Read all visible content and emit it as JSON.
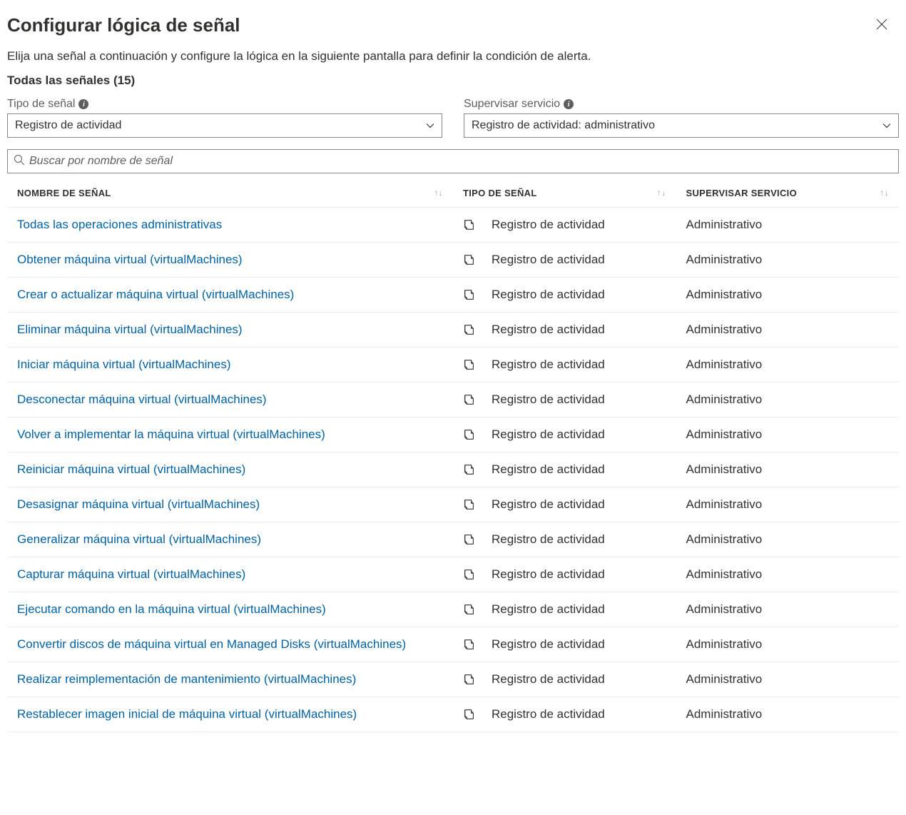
{
  "header": {
    "title": "Configurar lógica de señal"
  },
  "description": "Elija una señal a continuación y configure la lógica en la siguiente pantalla para definir la condición de alerta.",
  "countLabel": "Todas las señales (15)",
  "filters": {
    "signalType": {
      "label": "Tipo de señal",
      "value": "Registro de actividad"
    },
    "monitorService": {
      "label": "Supervisar servicio",
      "value": "Registro de actividad: administrativo"
    }
  },
  "search": {
    "placeholder": "Buscar por nombre de señal"
  },
  "table": {
    "columns": {
      "name": "Nombre de señal",
      "type": "Tipo de señal",
      "service": "Supervisar servicio"
    },
    "rows": [
      {
        "name": "Todas las operaciones administrativas",
        "type": "Registro de actividad",
        "service": "Administrativo"
      },
      {
        "name": "Obtener máquina virtual (virtualMachines)",
        "type": "Registro de actividad",
        "service": "Administrativo"
      },
      {
        "name": "Crear o actualizar máquina virtual (virtualMachines)",
        "type": "Registro de actividad",
        "service": "Administrativo"
      },
      {
        "name": "Eliminar máquina virtual (virtualMachines)",
        "type": "Registro de actividad",
        "service": "Administrativo"
      },
      {
        "name": "Iniciar máquina virtual (virtualMachines)",
        "type": "Registro de actividad",
        "service": "Administrativo"
      },
      {
        "name": "Desconectar máquina virtual (virtualMachines)",
        "type": "Registro de actividad",
        "service": "Administrativo"
      },
      {
        "name": "Volver a implementar la máquina virtual (virtualMachines)",
        "type": "Registro de actividad",
        "service": "Administrativo"
      },
      {
        "name": "Reiniciar máquina virtual (virtualMachines)",
        "type": "Registro de actividad",
        "service": "Administrativo"
      },
      {
        "name": "Desasignar máquina virtual (virtualMachines)",
        "type": "Registro de actividad",
        "service": "Administrativo"
      },
      {
        "name": "Generalizar máquina virtual (virtualMachines)",
        "type": "Registro de actividad",
        "service": "Administrativo"
      },
      {
        "name": "Capturar máquina virtual (virtualMachines)",
        "type": "Registro de actividad",
        "service": "Administrativo"
      },
      {
        "name": "Ejecutar comando en la máquina virtual (virtualMachines)",
        "type": "Registro de actividad",
        "service": "Administrativo"
      },
      {
        "name": "Convertir discos de máquina virtual en Managed Disks (virtualMachines)",
        "type": "Registro de actividad",
        "service": "Administrativo"
      },
      {
        "name": "Realizar reimplementación de mantenimiento (virtualMachines)",
        "type": "Registro de actividad",
        "service": "Administrativo"
      },
      {
        "name": "Restablecer imagen inicial de máquina virtual (virtualMachines)",
        "type": "Registro de actividad",
        "service": "Administrativo"
      }
    ]
  }
}
